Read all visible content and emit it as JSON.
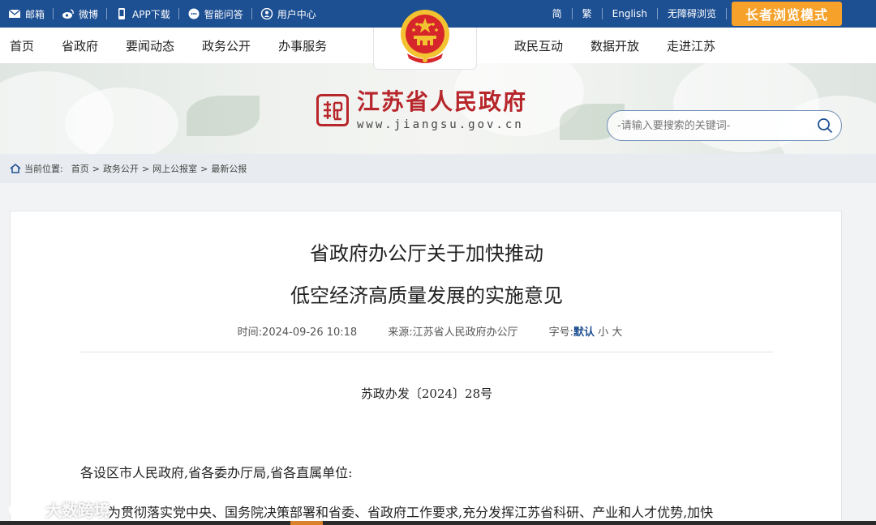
{
  "topbar": {
    "left_items": [
      {
        "label": "邮箱",
        "icon": "mail-icon"
      },
      {
        "label": "微博",
        "icon": "weibo-icon"
      },
      {
        "label": "APP下载",
        "icon": "phone-icon"
      },
      {
        "label": "智能问答",
        "icon": "chat-icon"
      },
      {
        "label": "用户中心",
        "icon": "user-icon"
      }
    ],
    "right_items": [
      "简",
      "繁",
      "English",
      "无障碍浏览"
    ],
    "elder_mode": "长者浏览模式"
  },
  "nav": {
    "left": [
      "首页",
      "省政府",
      "要闻动态",
      "政务公开",
      "办事服务"
    ],
    "right": [
      "政民互动",
      "数据开放",
      "走进江苏"
    ]
  },
  "site": {
    "name": "江苏省人民政府",
    "url": "www.jiangsu.gov.cn"
  },
  "search": {
    "placeholder": "-请输入要搜索的关键词-"
  },
  "breadcrumb": {
    "label": "当前位置:",
    "path": [
      "首页",
      "政务公开",
      "网上公报室",
      "最新公报"
    ],
    "separator": ">"
  },
  "article": {
    "title_line1": "省政府办公厅关于加快推动",
    "title_line2": "低空经济高质量发展的实施意见",
    "time_label": "时间:",
    "time": "2024-09-26 10:18",
    "source_label": "来源:",
    "source": "江苏省人民政府办公厅",
    "fontsize_label": "字号:",
    "fontsize_default": "默认",
    "fontsize_small": "小",
    "fontsize_large": "大",
    "doc_number": "苏政办发〔2024〕28号",
    "salutation": "各设区市人民政府,省各委办厅局,省各直属单位:",
    "para1": "为贯彻落实党中央、国务院决策部署和省委、省政府工作要求,充分发挥江苏省科研、产业和人才优势,加快"
  },
  "watermark": "大数跨境",
  "colors": {
    "topbar": "#1d4f93",
    "accent_orange": "#f5a12a",
    "brand_red": "#b7262b"
  }
}
